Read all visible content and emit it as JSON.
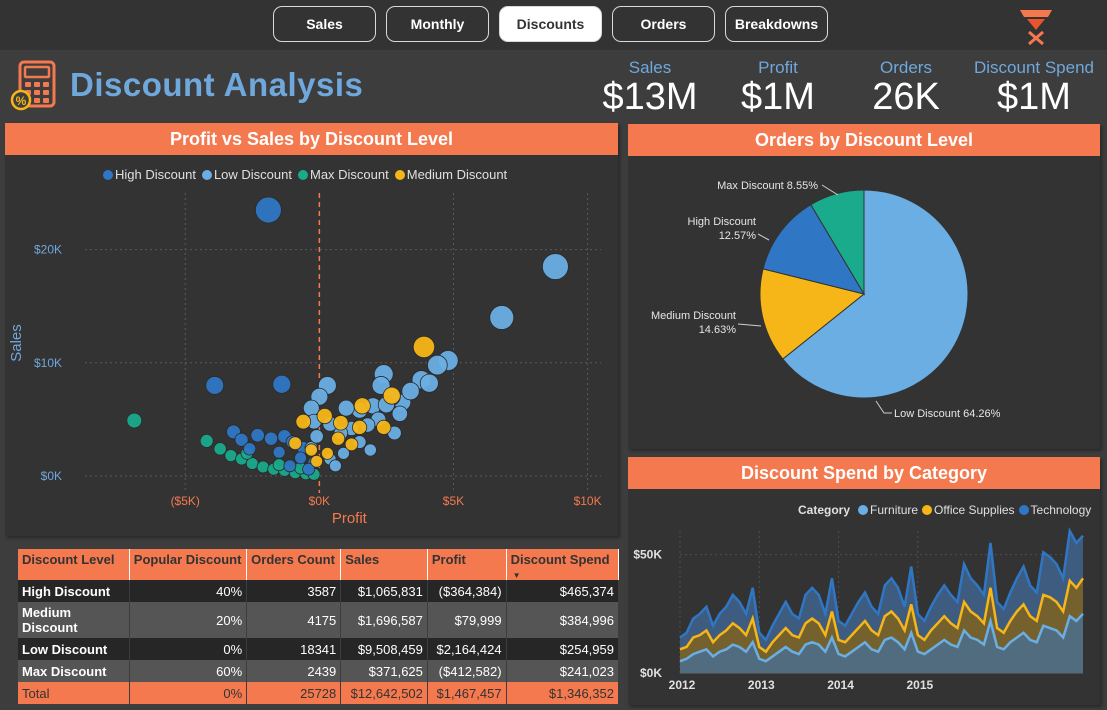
{
  "nav": {
    "tabs": [
      {
        "label": "Sales",
        "active": false
      },
      {
        "label": "Monthly",
        "active": false
      },
      {
        "label": "Discounts",
        "active": true
      },
      {
        "label": "Orders",
        "active": false
      },
      {
        "label": "Breakdowns",
        "active": false
      }
    ]
  },
  "header": {
    "title": "Discount Analysis",
    "kpis": [
      {
        "label": "Sales",
        "value": "$13M"
      },
      {
        "label": "Profit",
        "value": "$1M"
      },
      {
        "label": "Orders",
        "value": "26K"
      },
      {
        "label": "Discount Spend",
        "value": "$1M"
      }
    ]
  },
  "colors": {
    "accent": "#f4794f",
    "high": "#2f77c4",
    "low": "#6aaee3",
    "max": "#1aaa8c",
    "medium": "#f7b617",
    "title_blue": "#6fa8dc"
  },
  "scatter": {
    "title": "Profit vs Sales by Discount Level",
    "legend": [
      "High Discount",
      "Low Discount",
      "Max Discount",
      "Medium Discount"
    ],
    "chart_data": {
      "type": "scatter",
      "xlabel": "Profit",
      "ylabel": "Sales",
      "x_ticks": [
        "($5K)",
        "$0K",
        "$5K",
        "$10K"
      ],
      "y_ticks": [
        "$0K",
        "$10K",
        "$20K"
      ],
      "xlim": [
        -6500,
        10500
      ],
      "ylim": [
        -1500,
        25000
      ],
      "series": [
        {
          "name": "High Discount",
          "points": [
            [
              -1900,
              23500
            ],
            [
              -3900,
              8000
            ],
            [
              -1400,
              8100
            ],
            [
              -3200,
              3900
            ],
            [
              -2900,
              3200
            ],
            [
              -2300,
              3600
            ],
            [
              -1800,
              3300
            ],
            [
              -1300,
              3500
            ],
            [
              -1000,
              3000
            ],
            [
              -600,
              2500
            ],
            [
              -2600,
              2400
            ],
            [
              -1500,
              2100
            ],
            [
              -700,
              1600
            ],
            [
              -200,
              1200
            ],
            [
              -1100,
              900
            ],
            [
              -400,
              600
            ]
          ]
        },
        {
          "name": "Low Discount",
          "points": [
            [
              8800,
              18500
            ],
            [
              6800,
              14000
            ],
            [
              4800,
              10200
            ],
            [
              4400,
              9800
            ],
            [
              3800,
              8500
            ],
            [
              2400,
              9000
            ],
            [
              2300,
              8000
            ],
            [
              3100,
              6500
            ],
            [
              2700,
              7000
            ],
            [
              2000,
              6200
            ],
            [
              1500,
              5800
            ],
            [
              1000,
              6000
            ],
            [
              300,
              8000
            ],
            [
              0,
              7000
            ],
            [
              -300,
              6000
            ],
            [
              2200,
              5000
            ],
            [
              1800,
              4500
            ],
            [
              1200,
              4200
            ],
            [
              800,
              3800
            ],
            [
              400,
              4600
            ],
            [
              -200,
              4800
            ],
            [
              3000,
              5500
            ],
            [
              1500,
              3000
            ],
            [
              900,
              2000
            ],
            [
              400,
              1500
            ],
            [
              -300,
              2500
            ],
            [
              -100,
              3500
            ],
            [
              2500,
              6300
            ],
            [
              3400,
              7500
            ],
            [
              4100,
              8200
            ],
            [
              2800,
              3800
            ],
            [
              600,
              900
            ],
            [
              1900,
              2300
            ]
          ]
        },
        {
          "name": "Max Discount",
          "points": [
            [
              -6900,
              4900
            ],
            [
              -4200,
              3100
            ],
            [
              -3700,
              2400
            ],
            [
              -3300,
              1800
            ],
            [
              -2900,
              1500
            ],
            [
              -2500,
              1100
            ],
            [
              -2100,
              800
            ],
            [
              -1700,
              600
            ],
            [
              -1300,
              500
            ],
            [
              -900,
              300
            ],
            [
              -500,
              200
            ],
            [
              -200,
              150
            ],
            [
              -2700,
              2000
            ],
            [
              -1500,
              1000
            ],
            [
              -700,
              700
            ]
          ]
        },
        {
          "name": "Medium Discount",
          "points": [
            [
              3900,
              11400
            ],
            [
              2700,
              7100
            ],
            [
              1600,
              6200
            ],
            [
              200,
              5300
            ],
            [
              1500,
              4300
            ],
            [
              700,
              3300
            ],
            [
              -900,
              2900
            ],
            [
              -300,
              2300
            ],
            [
              1200,
              2800
            ],
            [
              -600,
              4800
            ],
            [
              2400,
              4300
            ],
            [
              300,
              2000
            ],
            [
              -100,
              1300
            ],
            [
              800,
              4700
            ]
          ]
        }
      ]
    }
  },
  "pie": {
    "title": "Orders by Discount Level",
    "chart_data": {
      "type": "pie",
      "labels": [
        "Low Discount",
        "Medium Discount",
        "High Discount",
        "Max Discount"
      ],
      "values": [
        64.26,
        14.63,
        12.57,
        8.55
      ],
      "label_text": [
        "Low Discount 64.26%",
        "Medium Discount",
        "14.63%",
        "High Discount",
        "12.57%",
        "Max Discount 8.55%"
      ]
    }
  },
  "table": {
    "headers": [
      "Discount Level",
      "Popular Discount",
      "Orders Count",
      "Sales",
      "Profit",
      "Discount Spend"
    ],
    "rows": [
      [
        "High Discount",
        "40%",
        "3587",
        "$1,065,831",
        "($364,384)",
        "$465,374"
      ],
      [
        "Medium Discount",
        "20%",
        "4175",
        "$1,696,587",
        "$79,999",
        "$384,996"
      ],
      [
        "Low Discount",
        "0%",
        "18341",
        "$9,508,459",
        "$2,164,424",
        "$254,959"
      ],
      [
        "Max Discount",
        "60%",
        "2439",
        "$371,625",
        "($412,582)",
        "$241,023"
      ]
    ],
    "total": [
      "Total",
      "0%",
      "25728",
      "$12,642,502",
      "$1,467,457",
      "$1,346,352"
    ]
  },
  "area": {
    "title": "Discount Spend by Category",
    "legend_title": "Category",
    "legend": [
      "Furniture",
      "Office Supplies",
      "Technology"
    ],
    "chart_data": {
      "type": "area",
      "x_ticks": [
        "2012",
        "2013",
        "2014",
        "2015"
      ],
      "y_ticks": [
        "$0K",
        "$50K"
      ],
      "ylim": [
        0,
        60000
      ],
      "series": [
        {
          "name": "Furniture",
          "values": [
            5000,
            6000,
            8000,
            9000,
            10000,
            7000,
            9000,
            10000,
            12000,
            11000,
            9000,
            13000,
            6000,
            5000,
            7000,
            9000,
            11000,
            9000,
            8000,
            12000,
            13000,
            12000,
            9000,
            15000,
            8000,
            7000,
            9000,
            11000,
            13000,
            10000,
            9000,
            14000,
            15000,
            13000,
            10000,
            17000,
            9000,
            8000,
            10000,
            12000,
            14000,
            12000,
            11000,
            18000,
            15000,
            14000,
            12000,
            22000,
            11000,
            10000,
            13000,
            15000,
            17000,
            14000,
            13000,
            20000,
            19000,
            18000,
            15000,
            24000,
            22000,
            25000
          ]
        },
        {
          "name": "Office Supplies",
          "values": [
            10000,
            11000,
            15000,
            16000,
            18000,
            13000,
            16000,
            18000,
            21000,
            19000,
            16000,
            23000,
            11000,
            9000,
            13000,
            16000,
            19000,
            16000,
            15000,
            21000,
            23000,
            21000,
            16000,
            26000,
            14000,
            13000,
            16000,
            19000,
            22000,
            18000,
            16000,
            24000,
            26000,
            23000,
            18000,
            29000,
            16000,
            14000,
            18000,
            21000,
            24000,
            21000,
            19000,
            30000,
            26000,
            24000,
            21000,
            36000,
            19000,
            17000,
            22000,
            26000,
            29000,
            24000,
            22000,
            33000,
            32000,
            30000,
            26000,
            39000,
            36000,
            40000
          ]
        },
        {
          "name": "Technology",
          "values": [
            15000,
            17000,
            23000,
            25000,
            28000,
            20000,
            25000,
            28000,
            33000,
            30000,
            25000,
            36000,
            17000,
            14000,
            20000,
            25000,
            30000,
            25000,
            23000,
            33000,
            36000,
            33000,
            25000,
            40000,
            22000,
            20000,
            25000,
            30000,
            34000,
            28000,
            25000,
            37000,
            40000,
            36000,
            28000,
            45000,
            25000,
            22000,
            28000,
            33000,
            37000,
            33000,
            30000,
            46000,
            40000,
            37000,
            33000,
            55000,
            30000,
            27000,
            34000,
            40000,
            45000,
            37000,
            34000,
            51000,
            49000,
            46000,
            40000,
            60000,
            55000,
            58000
          ]
        }
      ]
    }
  }
}
